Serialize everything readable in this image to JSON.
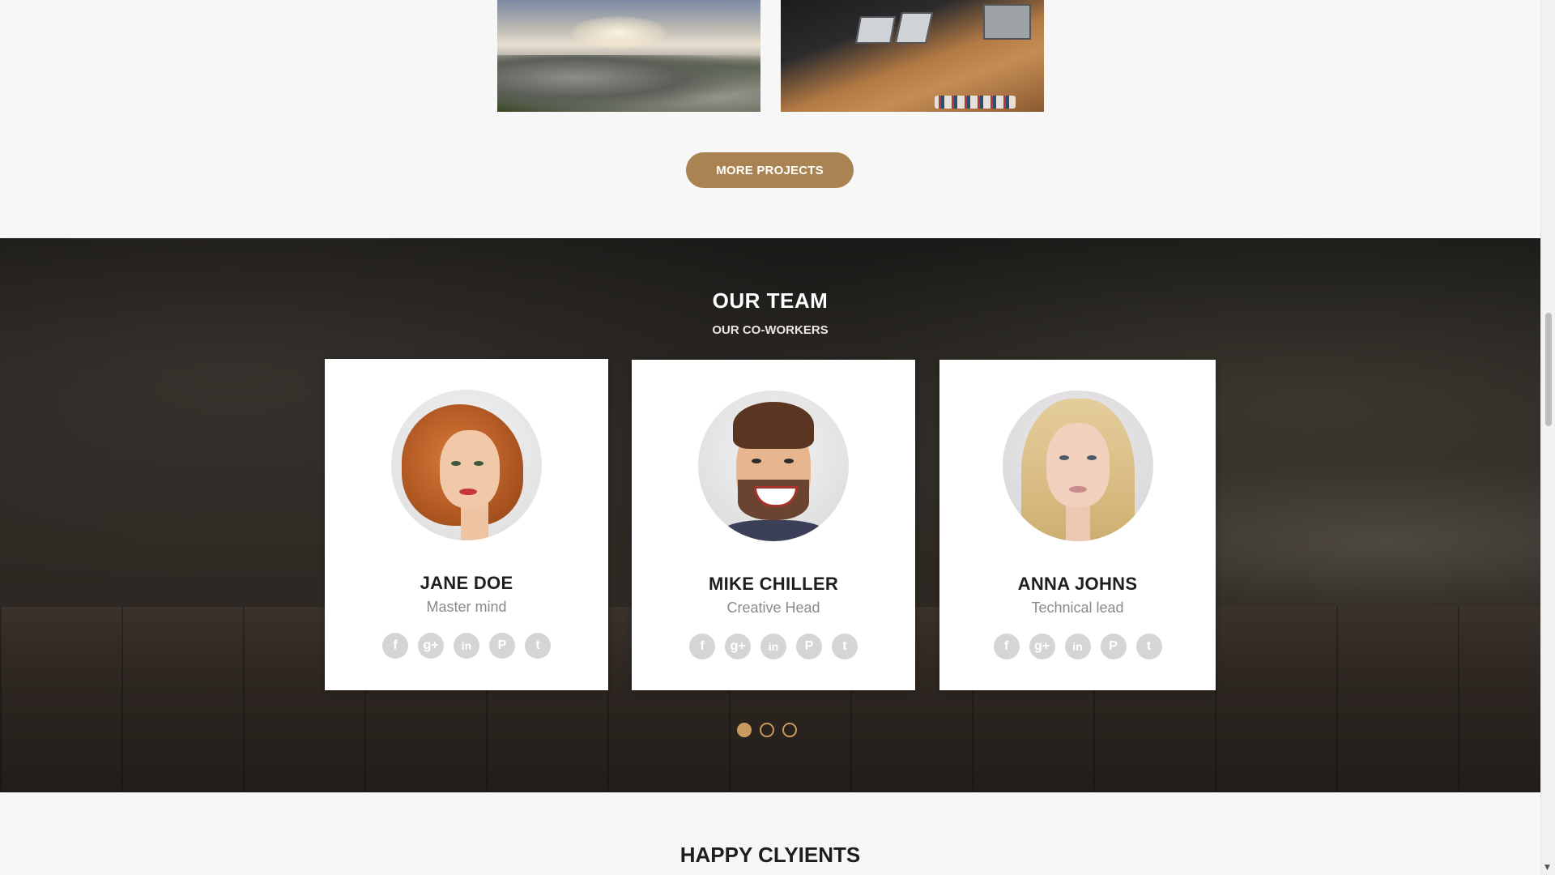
{
  "projects": {
    "images": [
      {
        "alt": "mountain-landscape-image"
      },
      {
        "alt": "office-desk-image"
      }
    ],
    "more_button_label": "MORE PROJECTS"
  },
  "team": {
    "title": "OUR TEAM",
    "subtitle": "OUR CO-WORKERS",
    "members": [
      {
        "name": "JANE DOE",
        "role": "Master mind"
      },
      {
        "name": "MIKE CHILLER",
        "role": "Creative Head"
      },
      {
        "name": "ANNA JOHNS",
        "role": "Technical lead"
      }
    ],
    "social_icons": [
      {
        "icon": "facebook-icon",
        "glyph": "f"
      },
      {
        "icon": "google-plus-icon",
        "glyph": "g+"
      },
      {
        "icon": "linkedin-icon",
        "glyph": "in"
      },
      {
        "icon": "pinterest-icon",
        "glyph": "P"
      },
      {
        "icon": "twitter-icon",
        "glyph": "t"
      }
    ],
    "carousel": {
      "pages": 3,
      "active_page": 1
    },
    "accent_color": "#a98352"
  },
  "clients": {
    "title": "HAPPY CLYIENTS"
  }
}
